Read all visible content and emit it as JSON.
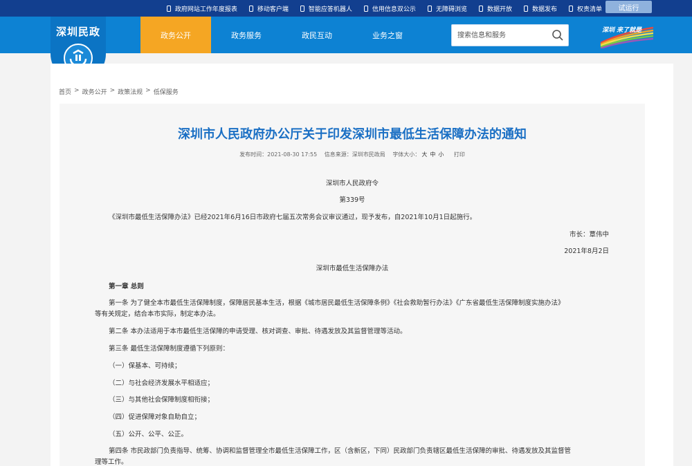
{
  "topbar": {
    "links": [
      "政府网站工作年度报表",
      "移动客户端",
      "智能应答机器人",
      "信用信息双公示",
      "无障碍浏览",
      "数据开放",
      "数据发布",
      "权责清单"
    ],
    "trial_button": "试运行"
  },
  "logo": {
    "title": "深圳民政"
  },
  "nav": {
    "items": [
      "政务公开",
      "政务服务",
      "政民互动",
      "业务之窗"
    ]
  },
  "search": {
    "placeholder": "搜索信息和服务"
  },
  "brand": {
    "text": "深圳 来了就是"
  },
  "breadcrumb": [
    "首页",
    "政务公开",
    "政策法规",
    "低保服务"
  ],
  "article": {
    "title": "深圳市人民政府办公厅关于印发深圳市最低生活保障办法的通知",
    "meta": {
      "published": "发布时间：2021-08-30 17:55",
      "source": "信息来源：深圳市民政局",
      "font_label": "字体大小：",
      "sizes": [
        "大",
        "中",
        "小"
      ],
      "print": "打印"
    },
    "decree_issuer": "深圳市人民政府令",
    "decree_number": "第339号",
    "intro": "《深圳市最低生活保障办法》已经2021年6月16日市政府七届五次常务会议审议通过，现予发布，自2021年10月1日起施行。",
    "mayor": "市长：覃伟中",
    "date": "2021年8月2日",
    "doc_title": "深圳市最低生活保障办法",
    "chapter1": "第一章 总则",
    "art1_line1": "第一条  为了健全本市最低生活保障制度，保障居民基本生活，根据《城市居民最低生活保障条例》《社会救助暂行办法》《广东省最低生活保障制度实施办法》",
    "art1_line2": "等有关规定，结合本市实际，制定本办法。",
    "art2": "第二条  本办法适用于本市最低生活保障的申请受理、核对调查、审批、待遇发放及其监督管理等活动。",
    "art3": "第三条  最低生活保障制度遵循下列原则：",
    "principles": [
      "（一）保基本、可持续；",
      "（二）与社会经济发展水平相适应；",
      "（三）与其他社会保障制度相衔接；",
      "（四）促进保障对象自助自立；",
      "（五）公开、公平、公正。"
    ],
    "art4_line1": "第四条  市民政部门负责指导、统筹、协调和监督管理全市最低生活保障工作，区（含新区，下同）民政部门负责辖区最低生活保障的审批、待遇发放及其监督管",
    "art4_line2": "理等工作。"
  }
}
